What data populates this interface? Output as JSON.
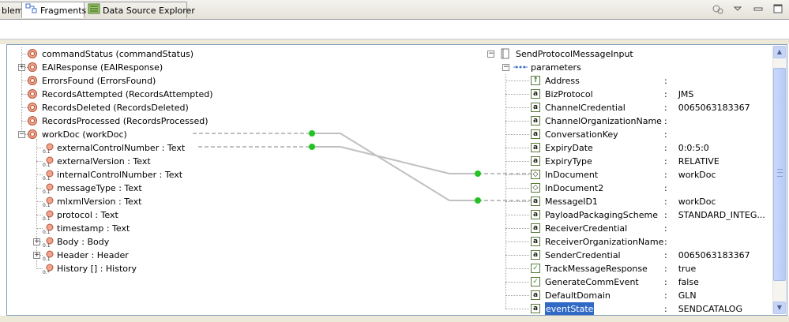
{
  "tabs": [
    {
      "label": "blems",
      "icon": "problems-icon",
      "active": false
    },
    {
      "label": "Fragments",
      "icon": "fragments-icon",
      "active": true
    },
    {
      "label": "Data Source Explorer",
      "icon": "data-source-explorer-icon",
      "active": false
    }
  ],
  "left_tree": [
    {
      "label": "commandStatus (commandStatus)",
      "icon": "element-icon"
    },
    {
      "label": "EAIResponse (EAIResponse)",
      "icon": "element-icon",
      "expander": "+"
    },
    {
      "label": "ErrorsFound (ErrorsFound)",
      "icon": "element-icon"
    },
    {
      "label": "RecordsAttempted (RecordsAttempted)",
      "icon": "element-icon"
    },
    {
      "label": "RecordsDeleted (RecordsDeleted)",
      "icon": "element-icon"
    },
    {
      "label": "RecordsProcessed (RecordsProcessed)",
      "icon": "element-icon"
    },
    {
      "label": "workDoc (workDoc)",
      "icon": "element-icon",
      "expander": "−"
    },
    {
      "label": "externalControlNumber  : Text",
      "icon": "field-0-1-icon"
    },
    {
      "label": "externalVersion  : Text",
      "icon": "field-0-1-icon"
    },
    {
      "label": "internalControlNumber  : Text",
      "icon": "field-0-1-icon"
    },
    {
      "label": "messageType  : Text",
      "icon": "field-0-1-icon"
    },
    {
      "label": "mlxmlVersion  : Text",
      "icon": "field-0-1-icon"
    },
    {
      "label": "protocol  : Text",
      "icon": "field-0-1-icon"
    },
    {
      "label": "timestamp  : Text",
      "icon": "field-0-1-icon"
    },
    {
      "label": "Body  : Body",
      "icon": "field-0-1-icon",
      "expander": "+"
    },
    {
      "label": "Header  : Header",
      "icon": "field-0-1-icon",
      "expander": "+"
    },
    {
      "label": "History [] : History",
      "icon": "field-0-many-icon"
    }
  ],
  "right_tree": {
    "root": "SendProtocolMessageInput",
    "group": "parameters",
    "params": [
      {
        "name": "Address",
        "value": ":",
        "icon": "attribute-arrow-icon"
      },
      {
        "name": "BizProtocol",
        "value": ":    JMS",
        "icon": "attribute-text-icon"
      },
      {
        "name": "ChannelCredential",
        "value": ":    0065063183367",
        "icon": "attribute-text-icon"
      },
      {
        "name": "ChannelOrganizationName",
        "value": ":",
        "icon": "attribute-text-icon"
      },
      {
        "name": "ConversationKey",
        "value": ":",
        "icon": "attribute-text-icon"
      },
      {
        "name": "ExpiryDate",
        "value": ":    0:0:5:0",
        "icon": "attribute-text-icon"
      },
      {
        "name": "ExpiryType",
        "value": ":    RELATIVE",
        "icon": "attribute-text-icon"
      },
      {
        "name": "InDocument",
        "value": ":    workDoc",
        "icon": "attribute-doc-icon"
      },
      {
        "name": "InDocument2",
        "value": ":",
        "icon": "attribute-doc-icon"
      },
      {
        "name": "MessageID1",
        "value": ":    workDoc",
        "icon": "attribute-text-icon"
      },
      {
        "name": "PayloadPackagingScheme",
        "value": ":    STANDARD_INTEG...",
        "icon": "attribute-text-icon"
      },
      {
        "name": "ReceiverCredential",
        "value": ":",
        "icon": "attribute-text-icon"
      },
      {
        "name": "ReceiverOrganizationName",
        "value": ":",
        "icon": "attribute-text-icon"
      },
      {
        "name": "SenderCredential",
        "value": ":    0065063183367",
        "icon": "attribute-text-icon"
      },
      {
        "name": "TrackMessageResponse",
        "value": ":    true",
        "icon": "attribute-check-icon"
      },
      {
        "name": "GenerateCommEvent",
        "value": ":    false",
        "icon": "attribute-check-icon"
      },
      {
        "name": "DefaultDomain",
        "value": ":    GLN",
        "icon": "attribute-text-icon"
      },
      {
        "name": "eventState",
        "value": ":    SENDCATALOG",
        "icon": "attribute-text-icon",
        "selected": true
      }
    ]
  },
  "colors": {
    "connector": "#c0c0c0",
    "anchor": "#22c322",
    "selection": "#316ac5",
    "element_icon": "#f3a28b"
  }
}
